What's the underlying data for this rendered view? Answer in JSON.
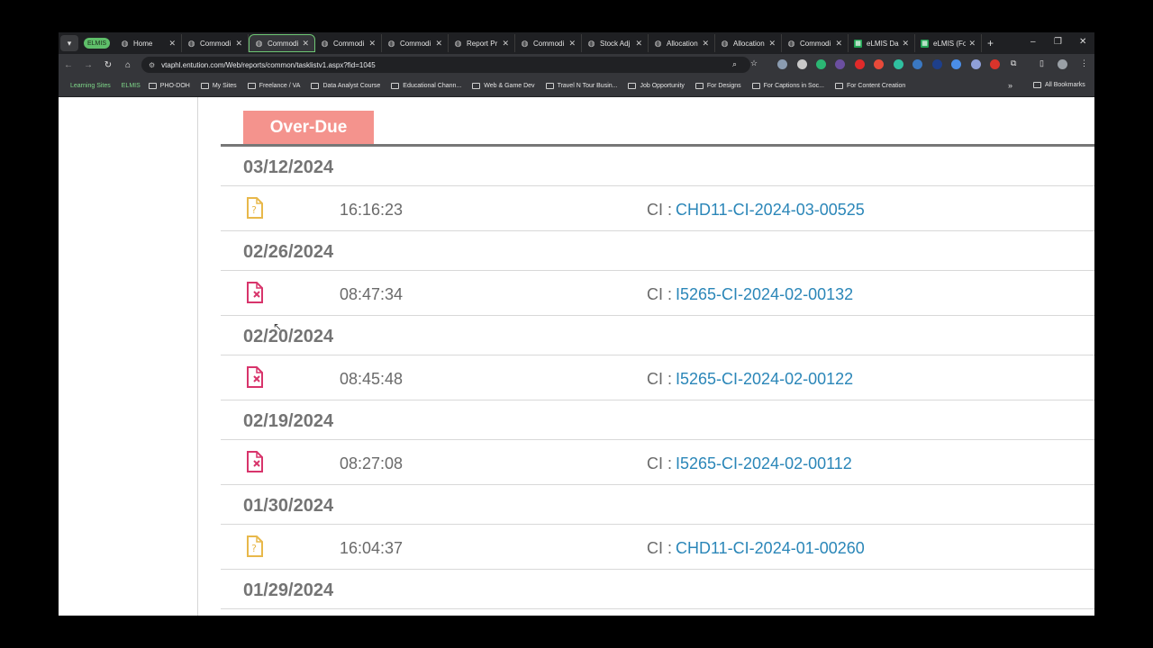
{
  "browser": {
    "group_chip": "ELMIS",
    "tabs": [
      {
        "label": "Home",
        "icon": "globe-icon",
        "active": false
      },
      {
        "label": "Commodi",
        "icon": "globe-icon",
        "active": false
      },
      {
        "label": "Commodi",
        "icon": "globe-icon",
        "active": true
      },
      {
        "label": "Commodi",
        "icon": "globe-icon",
        "active": false
      },
      {
        "label": "Commodi",
        "icon": "globe-icon",
        "active": false
      },
      {
        "label": "Report Pr",
        "icon": "globe-icon",
        "active": false
      },
      {
        "label": "Commodi",
        "icon": "globe-icon",
        "active": false
      },
      {
        "label": "Stock Adj",
        "icon": "globe-icon",
        "active": false
      },
      {
        "label": "Allocation",
        "icon": "globe-icon",
        "active": false
      },
      {
        "label": "Allocation",
        "icon": "globe-icon",
        "active": false
      },
      {
        "label": "Commodi",
        "icon": "globe-icon",
        "active": false
      },
      {
        "label": "eLMIS Da",
        "icon": "sheets-icon",
        "active": false
      },
      {
        "label": "eLMIS (Fo",
        "icon": "sheets-icon",
        "active": false
      }
    ],
    "url": "vtaphl.entution.com/Web/reports/common/tasklistv1.aspx?fid=1045",
    "bookmarks": [
      {
        "label": "Learning Sites",
        "type": "chip"
      },
      {
        "label": "ELMIS",
        "type": "chip"
      },
      {
        "label": "PHO-DOH",
        "type": "folder"
      },
      {
        "label": "My Sites",
        "type": "folder"
      },
      {
        "label": "Freelance / VA",
        "type": "folder"
      },
      {
        "label": "Data Analyst Course",
        "type": "folder"
      },
      {
        "label": "Educational Chann...",
        "type": "folder"
      },
      {
        "label": "Web & Game Dev",
        "type": "folder"
      },
      {
        "label": "Travel N Tour Busin...",
        "type": "folder"
      },
      {
        "label": "Job Opportunity",
        "type": "folder"
      },
      {
        "label": "For Designs",
        "type": "folder"
      },
      {
        "label": "For Captions in Soc...",
        "type": "folder"
      },
      {
        "label": "For Content Creation",
        "type": "folder"
      }
    ],
    "all_bookmarks": "All Bookmarks"
  },
  "page": {
    "section_badge": "Over-Due",
    "groups": [
      {
        "date": "03/12/2024",
        "items": [
          {
            "time": "16:16:23",
            "prefix": "CI :",
            "ref": "CHD11-CI-2024-03-00525",
            "icon": "pending-document-icon"
          }
        ]
      },
      {
        "date": "02/26/2024",
        "items": [
          {
            "time": "08:47:34",
            "prefix": "CI :",
            "ref": "I5265-CI-2024-02-00132",
            "icon": "rejected-document-icon"
          }
        ]
      },
      {
        "date": "02/20/2024",
        "items": [
          {
            "time": "08:45:48",
            "prefix": "CI :",
            "ref": "I5265-CI-2024-02-00122",
            "icon": "rejected-document-icon"
          }
        ]
      },
      {
        "date": "02/19/2024",
        "items": [
          {
            "time": "08:27:08",
            "prefix": "CI :",
            "ref": "I5265-CI-2024-02-00112",
            "icon": "rejected-document-icon"
          }
        ]
      },
      {
        "date": "01/30/2024",
        "items": [
          {
            "time": "16:04:37",
            "prefix": "CI :",
            "ref": "CHD11-CI-2024-01-00260",
            "icon": "pending-document-icon"
          }
        ]
      },
      {
        "date": "01/29/2024",
        "items": []
      }
    ],
    "colors": {
      "badge": "#f4938d",
      "link": "#2a86b8",
      "pending_icon": "#e8b84a",
      "rejected_icon": "#d8346b"
    }
  }
}
